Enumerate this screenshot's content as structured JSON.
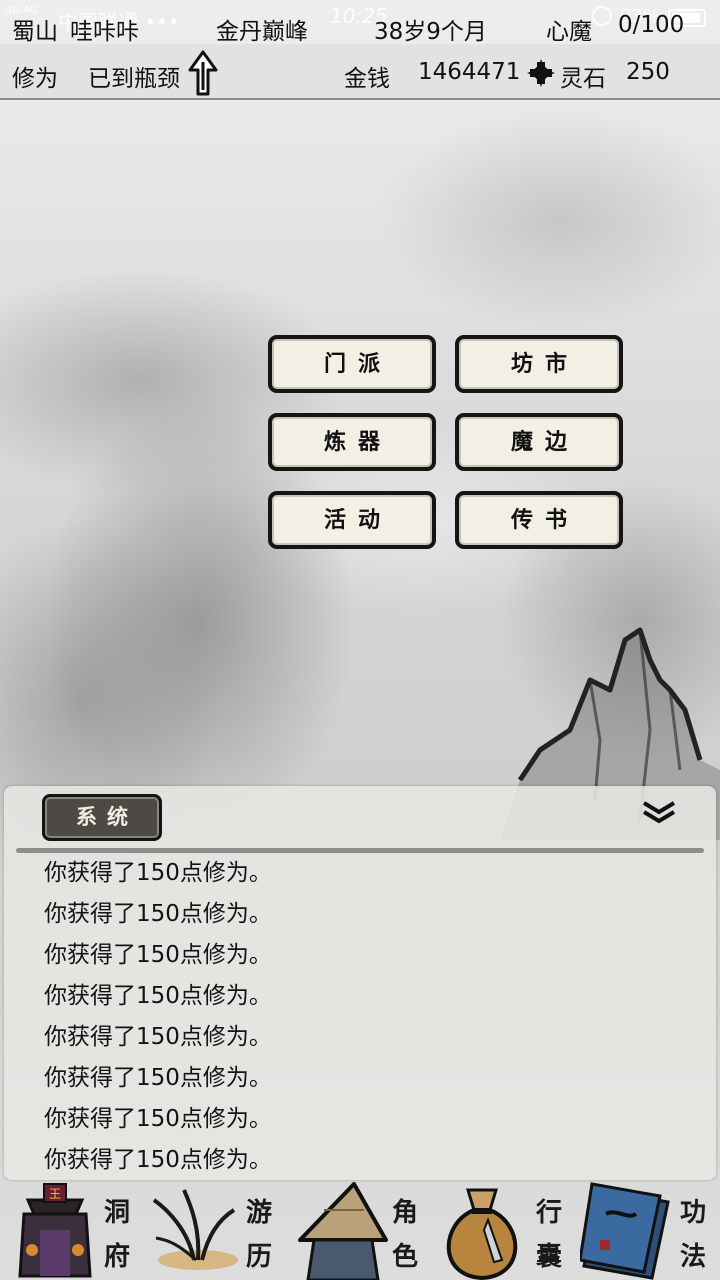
{
  "status_bar": {
    "network": "4G 4G",
    "carrier": "中国联通 •••",
    "time": "10:25",
    "battery": "93%"
  },
  "header": {
    "location": "蜀山",
    "name": "哇咔咔",
    "realm": "金丹巅峰",
    "age": "38岁9个月",
    "demon_label": "心魔",
    "demon_value": "0/100",
    "cultivation_label": "修为",
    "cultivation_value": "已到瓶颈",
    "money_label": "金钱",
    "money_value": "1464471",
    "stone_label": "灵石",
    "stone_value": "250"
  },
  "menu": {
    "sect": "门派",
    "market": "坊市",
    "forge": "炼器",
    "demon_border": "魔边",
    "events": "活动",
    "messages": "传书"
  },
  "log": {
    "tab_label": "系统",
    "lines": [
      "你获得了150点修为。",
      "你获得了150点修为。",
      "你获得了150点修为。",
      "你获得了150点修为。",
      "你获得了150点修为。",
      "你获得了150点修为。",
      "你获得了150点修为。",
      "你获得了150点修为。"
    ]
  },
  "bottom_nav": [
    {
      "icon": "cave-mansion-icon",
      "char1": "洞",
      "char2": "府"
    },
    {
      "icon": "travel-grass-icon",
      "char1": "游",
      "char2": "历"
    },
    {
      "icon": "straw-hat-character-icon",
      "char1": "角",
      "char2": "色"
    },
    {
      "icon": "pouch-bag-icon",
      "char1": "行",
      "char2": "囊"
    },
    {
      "icon": "technique-books-icon",
      "char1": "功",
      "char2": "法"
    }
  ]
}
